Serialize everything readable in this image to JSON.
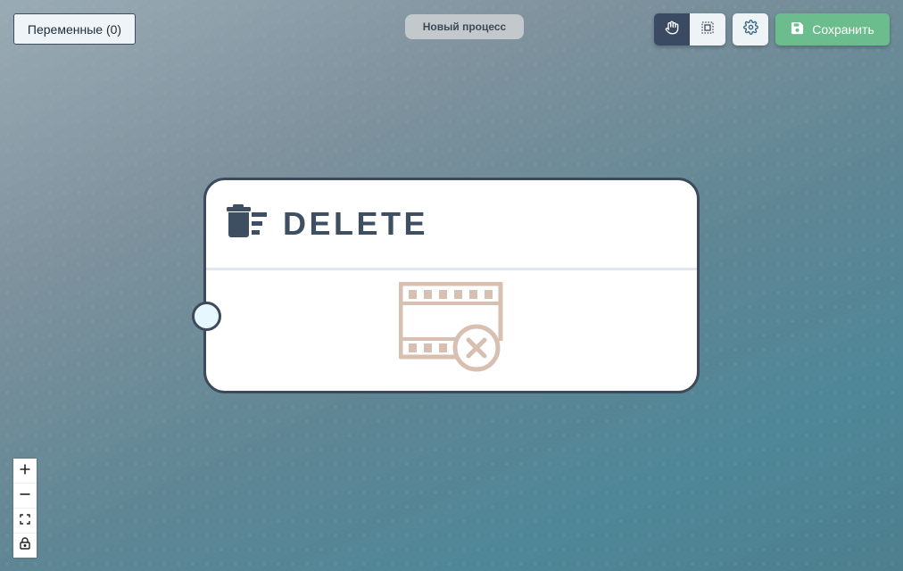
{
  "toolbar": {
    "variables_label": "Переменные (0)",
    "save_label": "Сохранить",
    "mode_buttons": [
      {
        "name": "hand-pan",
        "active": true
      },
      {
        "name": "selection",
        "active": false
      }
    ]
  },
  "process": {
    "name": "Новый процесс"
  },
  "node": {
    "title": "DELETE",
    "icon": "trash-lines-icon",
    "body_icon": "film-delete-icon"
  },
  "zoom_controls": [
    "zoom-in",
    "zoom-out",
    "fit-view",
    "lock"
  ],
  "colors": {
    "save": "#6cbd8e",
    "node_border": "#3c4a5c",
    "active_mode": "#3a4a63",
    "film_icon": "#d7bfb2"
  }
}
